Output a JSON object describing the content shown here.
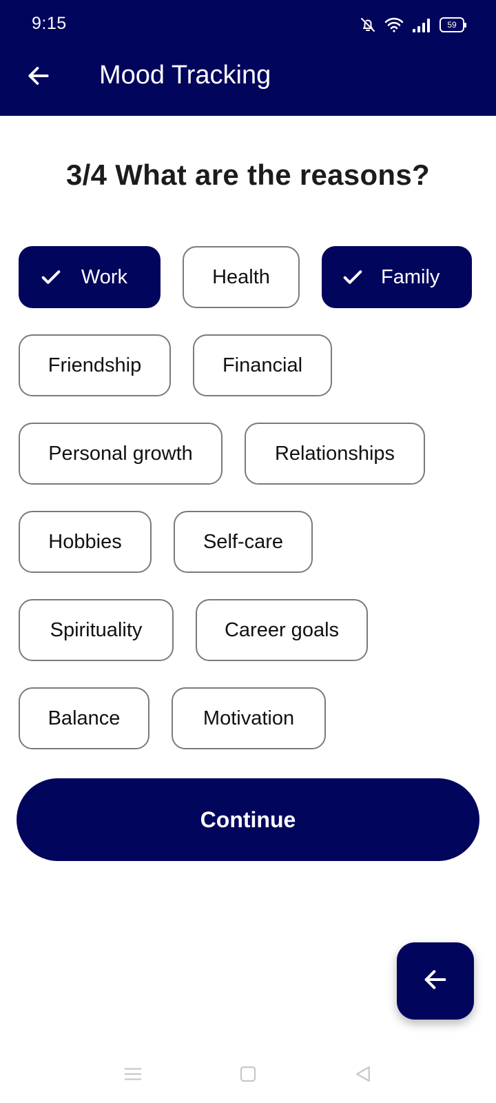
{
  "status_bar": {
    "time": "9:15",
    "battery": "59",
    "icons": [
      "bell-off-icon",
      "wifi-icon",
      "signal-icon",
      "battery-icon"
    ]
  },
  "app_bar": {
    "title": "Mood Tracking",
    "back_icon": "arrow-left-icon"
  },
  "question": "3/4 What are the reasons?",
  "chips": [
    [
      {
        "label": "Work",
        "selected": true
      },
      {
        "label": "Health",
        "selected": false
      },
      {
        "label": "Family",
        "selected": true
      }
    ],
    [
      {
        "label": "Friendship",
        "selected": false
      },
      {
        "label": "Financial",
        "selected": false
      }
    ],
    [
      {
        "label": "Personal growth",
        "selected": false
      },
      {
        "label": "Relationships",
        "selected": false
      }
    ],
    [
      {
        "label": "Hobbies",
        "selected": false
      },
      {
        "label": "Self-care",
        "selected": false
      }
    ],
    [
      {
        "label": "Spirituality",
        "selected": false
      },
      {
        "label": "Career goals",
        "selected": false
      }
    ],
    [
      {
        "label": "Balance",
        "selected": false
      },
      {
        "label": "Motivation",
        "selected": false
      }
    ]
  ],
  "continue_label": "Continue",
  "fab_icon": "arrow-left-icon",
  "colors": {
    "primary": "#02055c",
    "chip_border": "#7a7a7a",
    "text_dark": "#1c1c1c"
  },
  "nav_bar": [
    "menu-icon",
    "home-square-icon",
    "back-triangle-icon"
  ]
}
